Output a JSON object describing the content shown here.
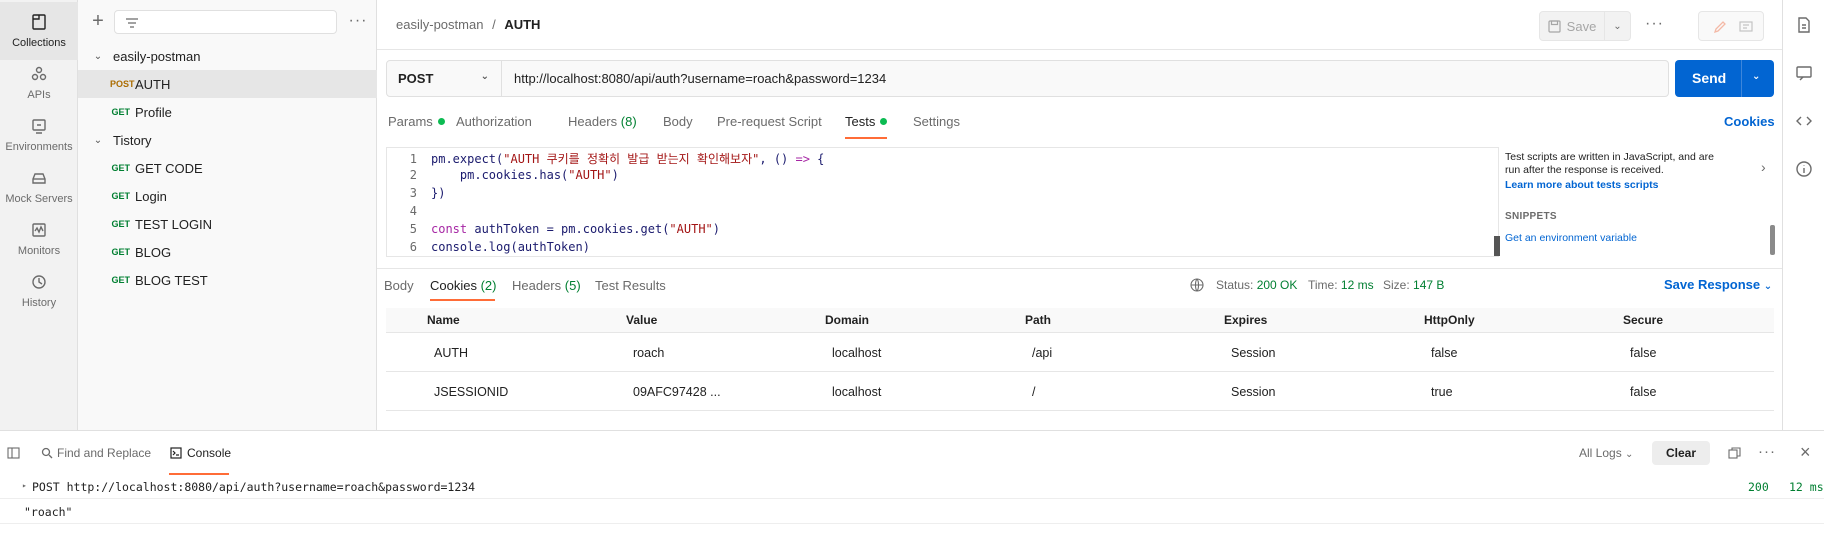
{
  "rail": {
    "items": [
      {
        "label": "Collections",
        "icon": "collections-icon",
        "active": true
      },
      {
        "label": "APIs",
        "icon": "apis-icon"
      },
      {
        "label": "Environments",
        "icon": "environments-icon"
      },
      {
        "label": "Mock Servers",
        "icon": "mock-servers-icon"
      },
      {
        "label": "Monitors",
        "icon": "monitors-icon"
      },
      {
        "label": "History",
        "icon": "history-icon"
      }
    ]
  },
  "sidebar": {
    "more": "···",
    "tree": [
      {
        "label": "easily-postman",
        "type": "collection"
      },
      {
        "label": "AUTH",
        "method": "POST",
        "selected": true
      },
      {
        "label": "Profile",
        "method": "GET"
      },
      {
        "label": "Tistory",
        "type": "collection"
      },
      {
        "label": "GET CODE",
        "method": "GET"
      },
      {
        "label": "Login",
        "method": "GET"
      },
      {
        "label": "TEST LOGIN",
        "method": "GET"
      },
      {
        "label": "BLOG",
        "method": "GET"
      },
      {
        "label": "BLOG TEST",
        "method": "GET"
      }
    ]
  },
  "header": {
    "breadcrumb_parent": "easily-postman",
    "breadcrumb_sep": "/",
    "breadcrumb_current": "AUTH",
    "save_label": "Save",
    "more": "···"
  },
  "request": {
    "method": "POST",
    "url": "http://localhost:8080/api/auth?username=roach&password=1234",
    "send_label": "Send"
  },
  "tabs": {
    "params": "Params",
    "authorization": "Authorization",
    "headers": "Headers",
    "headers_count": "(8)",
    "body": "Body",
    "prerequest": "Pre-request Script",
    "tests": "Tests",
    "settings": "Settings",
    "cookies_link": "Cookies"
  },
  "editor": {
    "lines": [
      "1",
      "2",
      "3",
      "4",
      "5",
      "6"
    ]
  },
  "snippets": {
    "description": "Test scripts are written in JavaScript, and are run after the response is received.",
    "learn_more": "Learn more about tests scripts",
    "title": "SNIPPETS",
    "item": "Get an environment variable"
  },
  "response": {
    "tabs": {
      "body": "Body",
      "cookies": "Cookies",
      "cookies_count": "(2)",
      "headers": "Headers",
      "headers_count": "(5)",
      "test_results": "Test Results"
    },
    "status_label": "Status:",
    "status_value": "200 OK",
    "time_label": "Time:",
    "time_value": "12 ms",
    "size_label": "Size:",
    "size_value": "147 B",
    "save_response": "Save Response",
    "columns": [
      "Name",
      "Value",
      "Domain",
      "Path",
      "Expires",
      "HttpOnly",
      "Secure"
    ],
    "rows": [
      [
        "AUTH",
        "roach",
        "localhost",
        "/api",
        "Session",
        "false",
        "false"
      ],
      [
        "JSESSIONID",
        "09AFC97428 ...",
        "localhost",
        "/",
        "Session",
        "true",
        "false"
      ]
    ]
  },
  "footer": {
    "find_replace": "Find and Replace",
    "console": "Console",
    "all_logs": "All Logs",
    "clear": "Clear",
    "more": "···",
    "log_request": "POST http://localhost:8080/api/auth?username=roach&password=1234",
    "log_status": "200",
    "log_time": "12 ms",
    "log_output": "\"roach\""
  },
  "colors": {
    "accent": "#ff6c37",
    "primary": "#0265d2",
    "get": "#007f31",
    "post": "#ab6c00",
    "success": "#0cbb52"
  }
}
